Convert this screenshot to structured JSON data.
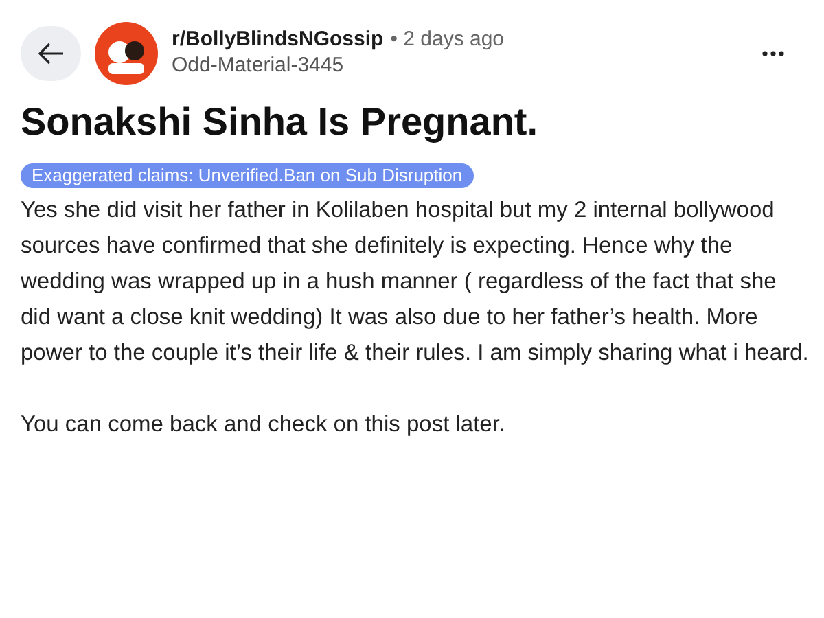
{
  "post": {
    "subreddit": "r/BollyBlindsNGossip",
    "time": "• 2 days ago",
    "author": "Odd-Material-3445",
    "title": "Sonakshi Sinha Is Pregnant.",
    "flair": "Exaggerated claims: Unverified.Ban on Sub Disruption",
    "body": [
      "Yes she did visit her father in Kolilaben hospital but my 2 internal bollywood sources have confirmed that she definitely is expecting. Hence why the wedding was wrapped up in a hush manner ( regardless of the fact that she did want a close knit wedding) It was also due to her father’s health. More power to the couple it’s their life & their rules. I am simply sharing what i heard.",
      "You can come back and check on this post later."
    ]
  }
}
